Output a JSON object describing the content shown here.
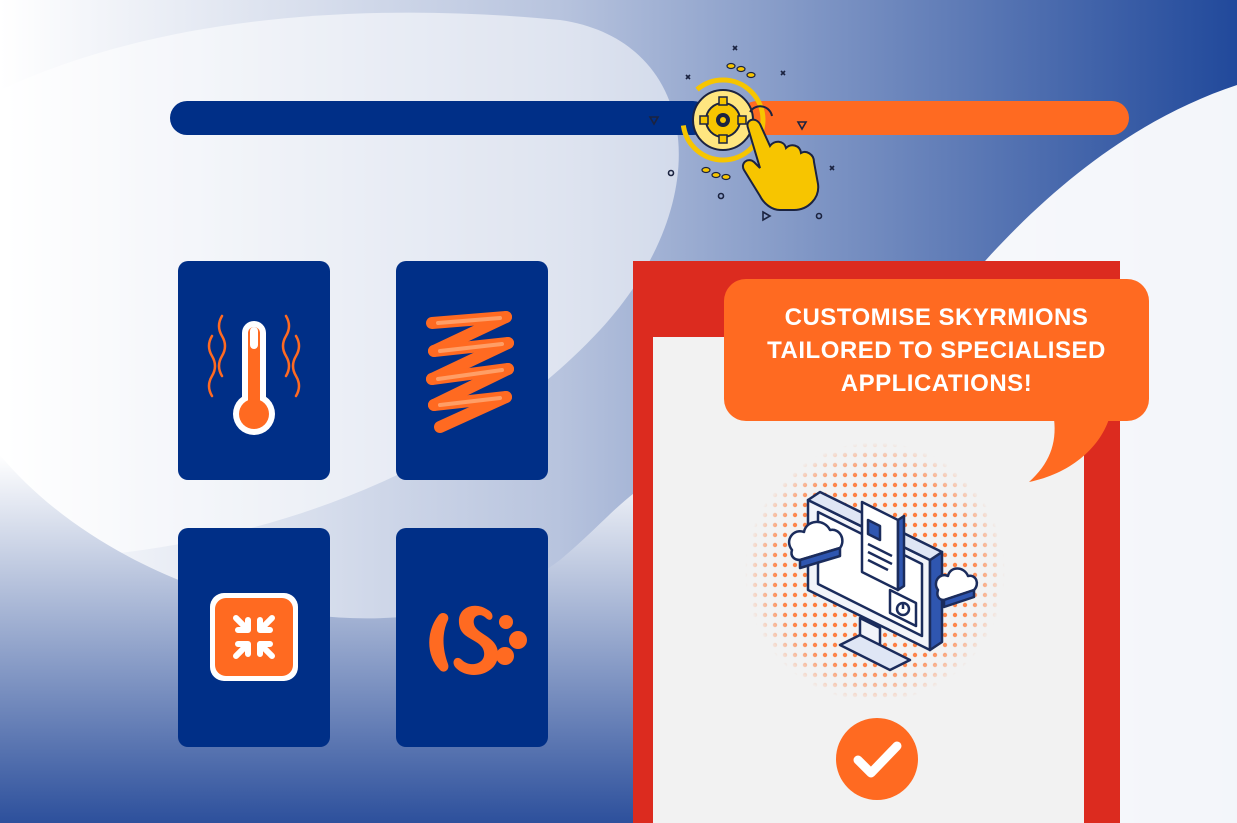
{
  "colors": {
    "navy": "#002f87",
    "orange": "#ff6a21",
    "red": "#dc2b1f",
    "yellow": "#f7c500",
    "panel_bg": "#f2f2f2"
  },
  "slider": {
    "handle_icon": "gear-touch-icon",
    "position": 0.58
  },
  "tiles": [
    {
      "icon": "thermometer-heat-icon"
    },
    {
      "icon": "spring-coil-icon"
    },
    {
      "icon": "compress-arrows-icon"
    },
    {
      "icon": "skyrmion-shapes-icon"
    }
  ],
  "bubble": {
    "lines": [
      "CUSTOMISE SKYRMIONS",
      "TAILORED TO SPECIALISED",
      "APPLICATIONS!"
    ]
  },
  "illustration": {
    "icon": "cloud-computer-isometric-icon"
  },
  "confirm": {
    "icon": "checkmark-icon"
  }
}
